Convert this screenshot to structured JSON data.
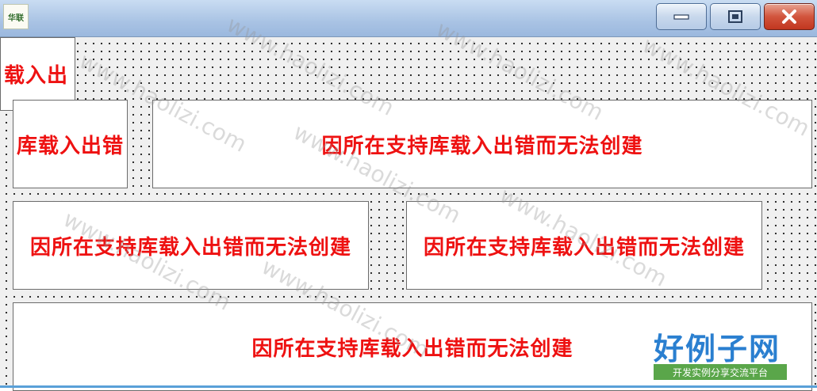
{
  "window": {
    "icon_text": "华联",
    "controls": {
      "minimize": "minimize-icon",
      "maximize": "maximize-icon",
      "close": "close-icon"
    }
  },
  "panels": {
    "p1": "载入出",
    "p2": "库载入出错",
    "p3": "因所在支持库载入出错而无法创建",
    "p4": "因所在支持库载入出错而无法创建",
    "p5": "因所在支持库载入出错而无法创建",
    "p6": "因所在支持库载入出错而无法创建"
  },
  "watermark": {
    "text": "www.haolizi.com",
    "logo_main": "好例子网",
    "logo_sub": "开发实例分享交流平台"
  },
  "colors": {
    "panel_text": "#ee1111",
    "logo_blue": "#2a7fd0",
    "logo_green": "#5aa64a"
  }
}
